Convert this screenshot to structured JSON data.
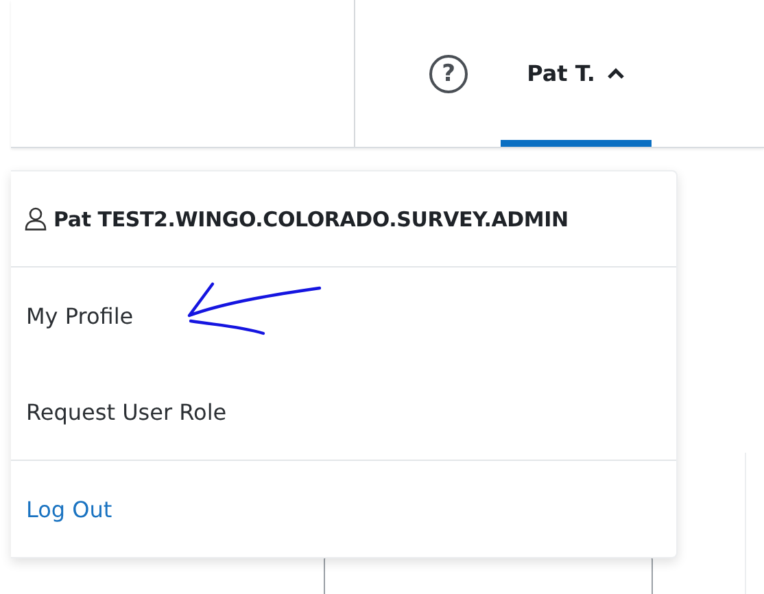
{
  "header": {
    "help": {
      "label": "?"
    },
    "user_menu": {
      "label": "Pat T.",
      "expanded": true
    }
  },
  "dropdown": {
    "user_name": "Pat TEST2.WINGO.COLORADO.SURVEY.ADMIN",
    "items": [
      {
        "label": "My Profile",
        "kind": "item"
      },
      {
        "label": "Request User Role",
        "kind": "item"
      },
      {
        "label": "Log Out",
        "kind": "link"
      }
    ]
  }
}
